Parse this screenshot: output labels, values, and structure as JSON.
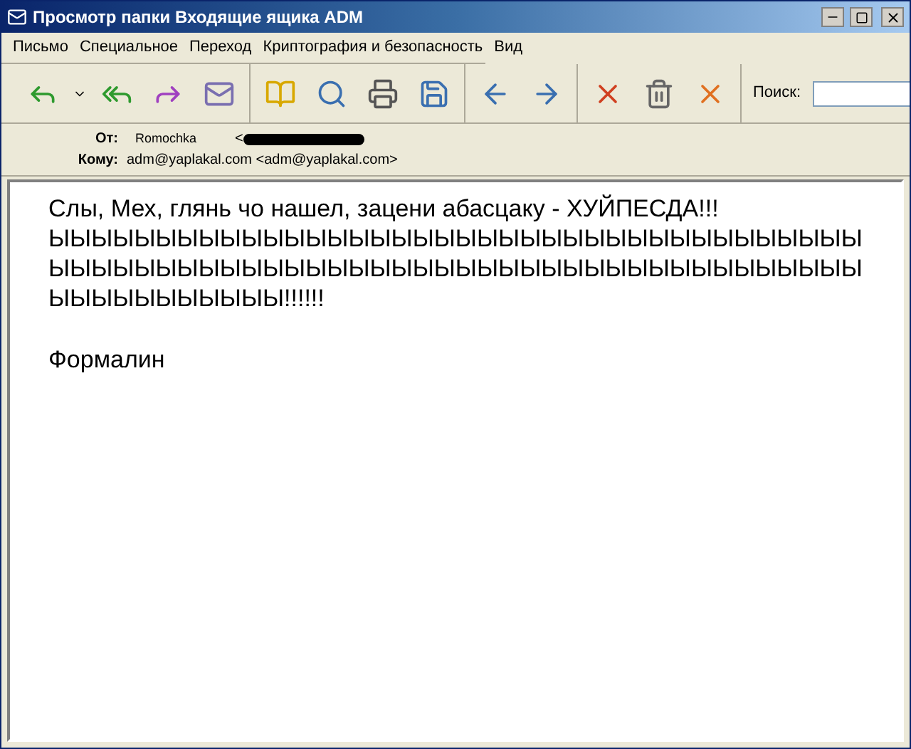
{
  "window": {
    "title": "Просмотр папки Входящие ящика ADM"
  },
  "menu": [
    "Письмо",
    "Специальное",
    "Переход",
    "Криптография и безопасность",
    "Вид"
  ],
  "toolbar": {
    "groups": [
      [
        {
          "kind": "reply"
        },
        {
          "kind": "reply-all"
        },
        {
          "kind": "forward"
        },
        {
          "kind": "forward-mail"
        }
      ],
      [
        {
          "kind": "address-book"
        },
        {
          "kind": "find"
        },
        {
          "kind": "print"
        },
        {
          "kind": "save"
        }
      ],
      [
        {
          "kind": "previous"
        },
        {
          "kind": "next"
        }
      ],
      [
        {
          "kind": "delete"
        },
        {
          "kind": "trash"
        },
        {
          "kind": "junk"
        }
      ]
    ],
    "search": {
      "label": "Поиск:"
    }
  },
  "header": {
    "from_label": "От:",
    "from_name": "Romochka",
    "from_address": "<",
    "to_label": "Кому:",
    "to_value": "adm@yaplakal.com <adm@yaplakal.com>"
  },
  "body": [
    "Слы, Мех, глянь чо нашел, зацени абасцаку - ХУЙПЕСДА!!! ЫЫЫЫЫЫЫЫЫЫЫЫЫЫЫЫЫЫЫЫЫЫЫЫЫЫЫЫЫЫЫЫЫЫЫЫЫЫЫЫЫЫЫЫЫЫЫЫЫЫЫЫЫЫЫЫЫЫЫЫЫЫЫЫЫЫЫЫЫЫЫЫЫЫЫЫЫЫЫЫЫЫЫЫЫЫЫ!!!!!!",
    "Формалин"
  ]
}
